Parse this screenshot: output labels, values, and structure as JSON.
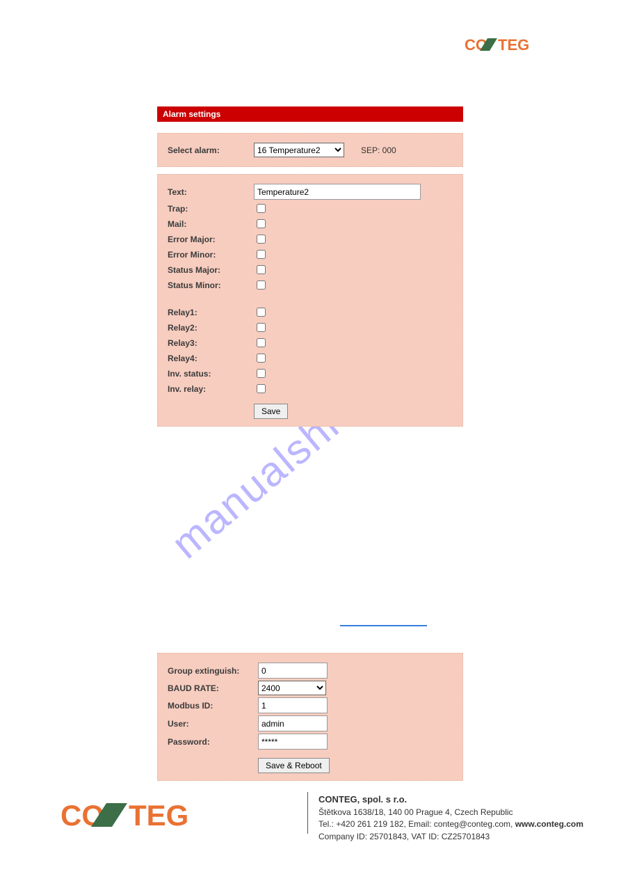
{
  "brand": {
    "top_text": "CONTEG",
    "bottom_text": "CONTEG"
  },
  "watermark": "manualshive.com",
  "panel1": {
    "title": "Alarm settings",
    "select_label": "Select alarm:",
    "select_value": "16 Temperature2",
    "sep_label": "SEP: 000"
  },
  "panel2": {
    "text_label": "Text:",
    "text_value": "Temperature2",
    "trap_label": "Trap:",
    "mail_label": "Mail:",
    "err_major_label": "Error Major:",
    "err_minor_label": "Error Minor:",
    "status_major_label": "Status Major:",
    "status_minor_label": "Status Minor:",
    "relay1_label": "Relay1:",
    "relay2_label": "Relay2:",
    "relay3_label": "Relay3:",
    "relay4_label": "Relay4:",
    "inv_status_label": "Inv. status:",
    "inv_relay_label": "Inv. relay:",
    "save_btn": "Save"
  },
  "panel3": {
    "group_ext_label": "Group extinguish:",
    "group_ext_value": "0",
    "baud_label": "BAUD RATE:",
    "baud_value": "2400",
    "modbus_label": "Modbus ID:",
    "modbus_value": "1",
    "user_label": "User:",
    "user_value": "admin",
    "password_label": "Password:",
    "password_value": "*****",
    "save_reboot_btn": "Save & Reboot"
  },
  "footer": {
    "company": "CONTEG, spol. s r.o.",
    "line1": "Štětkova 1638/18, 140 00 Prague 4, Czech Republic",
    "line2a": "Tel.: +420 261 219 182, Email: conteg@conteg.com, ",
    "line2b": "www.conteg.com",
    "line3": "Company ID: 25701843, VAT ID: CZ25701843"
  }
}
